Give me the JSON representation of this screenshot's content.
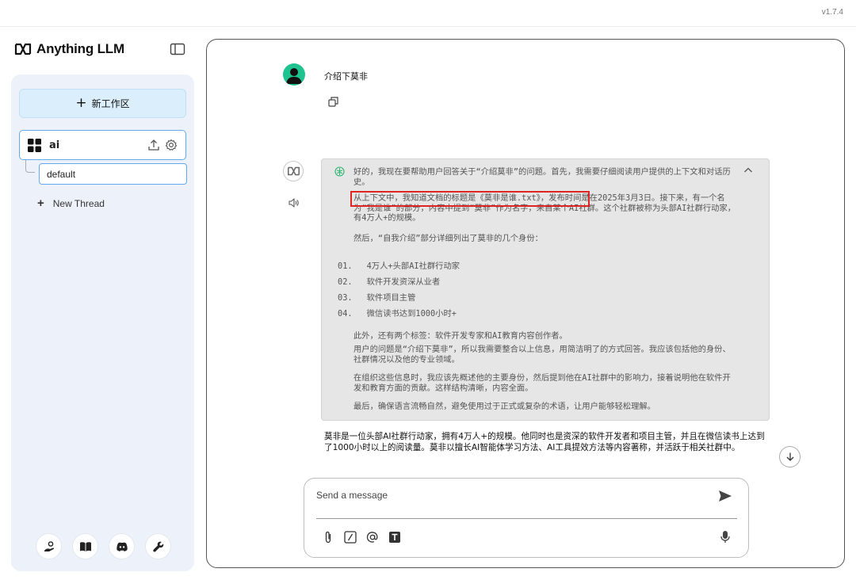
{
  "app": {
    "version": "v1.7.4",
    "brand": "Anything LLM"
  },
  "sidebar": {
    "new_workspace_label": "新工作区",
    "workspace": {
      "name": "ai"
    },
    "thread": {
      "name": "default"
    },
    "new_thread_label": "New Thread",
    "footer_icons": [
      "community-hub-icon",
      "docs-book-icon",
      "discord-icon",
      "settings-wrench-icon"
    ]
  },
  "chat": {
    "user_message": "介绍下莫非",
    "thinking": {
      "p1": "好的，我现在要帮助用户回答关于“介绍莫非”的问题。首先，我需要仔细阅读用户提供的上下文和对话历史。",
      "p2": "从上下文中，我知道文档的标题是《莫非是谁.txt》，发布时间是在2025年3月3日。接下来，有一个名为“我是谁”的部分，内容中提到“莫非”作为名字，来自某个AI社群。这个社群被称为头部AI社群行动家，有4万人+的规模。",
      "p3": "然后，“自我介绍”部分详细列出了莫非的几个身份：",
      "list": [
        {
          "num": "01.",
          "text": "4万人+头部AI社群行动家"
        },
        {
          "num": "02.",
          "text": "软件开发资深从业者"
        },
        {
          "num": "03.",
          "text": "软件项目主管"
        },
        {
          "num": "04.",
          "text": "微信读书达到1000小时+"
        }
      ],
      "p4": "此外，还有两个标签：软件开发专家和AI教育内容创作者。",
      "p5": "用户的问题是“介绍下莫非”，所以我需要整合以上信息，用简洁明了的方式回答。我应该包括他的身份、社群情况以及他的专业领域。",
      "p6": "在组织这些信息时，我应该先概述他的主要身份，然后提到他在AI社群中的影响力，接着说明他在软件开发和教育方面的贡献。这样结构清晰，内容全面。",
      "p7": "最后，确保语言流畅自然，避免使用过于正式或复杂的术语，让用户能够轻松理解。"
    },
    "answer": "莫非是一位头部AI社群行动家，拥有4万人+的规模。他同时也是资深的软件开发者和项目主管，并且在微信读书上达到了1000小时以上的阅读量。莫非以擅长AI智能体学习方法、AI工具提效方法等内容著称，并活跃于相关社群中。"
  },
  "composer": {
    "placeholder": "Send a message",
    "tool_icons": [
      "attach-icon",
      "slash-command-icon",
      "mention-icon",
      "text-format-icon"
    ]
  },
  "colors": {
    "accent": "#63a9ee",
    "avatar": "#1fc38f",
    "highlight": "#e02424",
    "think_bg": "#e6e6e6"
  }
}
